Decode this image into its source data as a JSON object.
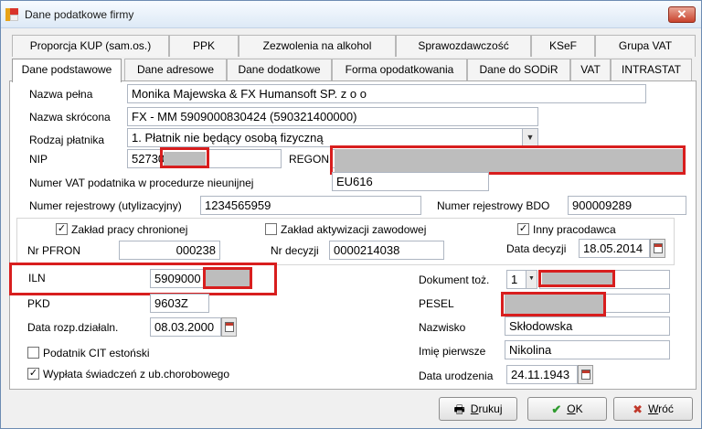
{
  "window": {
    "title": "Dane podatkowe firmy",
    "close_glyph": "✕"
  },
  "tabs_top": [
    "Proporcja KUP (sam.os.)",
    "PPK",
    "Zezwolenia na alkohol",
    "Sprawozdawczość",
    "KSeF",
    "Grupa VAT"
  ],
  "tabs_bottom": [
    "Dane podstawowe",
    "Dane adresowe",
    "Dane dodatkowe",
    "Forma opodatkowania",
    "Dane do SODiR",
    "VAT",
    "INTRASTAT"
  ],
  "form": {
    "nazwa_pelna": {
      "label": "Nazwa pełna",
      "value": "Monika Majewska & FX Humansoft SP. z o o"
    },
    "nazwa_skrocona": {
      "label": "Nazwa skrócona",
      "value": "FX - MM 5909000830424 (590321400000)"
    },
    "rodzaj_platnika": {
      "label": "Rodzaj płatnika",
      "value": "1. Płatnik nie będący osobą fizyczną"
    },
    "nip": {
      "label": "NIP",
      "value": "52730"
    },
    "regon": {
      "label": "REGON",
      "value": ""
    },
    "vat_nieunijny": {
      "label": "Numer VAT podatnika w procedurze nieunijnej",
      "value": "EU616"
    },
    "nr_rej_utyl": {
      "label": "Numer rejestrowy (utylizacyjny)",
      "value": "1234565959"
    },
    "nr_rej_bdo": {
      "label": "Numer rejestrowy  BDO",
      "value": "900009289"
    },
    "zaklad_chroniony": {
      "label": "Zakład pracy chronionej",
      "checked": true
    },
    "zaklad_aktywizacji": {
      "label": "Zakład  aktywizacji zawodowej",
      "checked": false
    },
    "inny_pracodawca": {
      "label": "Inny pracodawca",
      "checked": true
    },
    "nr_pfron": {
      "label": "Nr PFRON",
      "value": "000238"
    },
    "nr_decyzji": {
      "label": "Nr decyzji",
      "value": "0000214038"
    },
    "data_decyzji": {
      "label": "Data decyzji",
      "value": "18.05.2014"
    },
    "iln": {
      "label": "ILN",
      "value": "5909000"
    },
    "pkd": {
      "label": "PKD",
      "value": "9603Z"
    },
    "data_rozp": {
      "label": "Data rozp.działaln.",
      "value": "08.03.2000"
    },
    "cit_estonski": {
      "label": "Podatnik CIT estoński",
      "checked": false
    },
    "wyplata_swiadczen": {
      "label": "Wypłata świadczeń z ub.chorobowego",
      "checked": true
    },
    "dokument_toz": {
      "label": "Dokument toż.",
      "value": "1"
    },
    "pesel": {
      "label": "PESEL",
      "value": ""
    },
    "nazwisko": {
      "label": "Nazwisko",
      "value": "Skłodowska"
    },
    "imie": {
      "label": "Imię pierwsze",
      "value": "Nikolina"
    },
    "data_urodzenia": {
      "label": "Data urodzenia",
      "value": "24.11.1943"
    }
  },
  "buttons": {
    "drukuj": {
      "label": "Drukuj",
      "hotkey": "D",
      "rest": "rukuj"
    },
    "ok": {
      "label": "OK",
      "hotkey": "O",
      "rest": "K"
    },
    "wroc": {
      "label": "Wróć",
      "hotkey": "W",
      "rest": "róć"
    }
  },
  "colors": {
    "redaction_frame": "#d81e1e",
    "redaction_fill": "#bdbdbd",
    "ok_check": "#2e9b2e",
    "cancel_icon": "#c0392b"
  },
  "icons": {
    "print": "printer-icon",
    "ok": "checkmark-icon",
    "cancel": "cancel-icon",
    "calendar": "calendar-icon"
  }
}
